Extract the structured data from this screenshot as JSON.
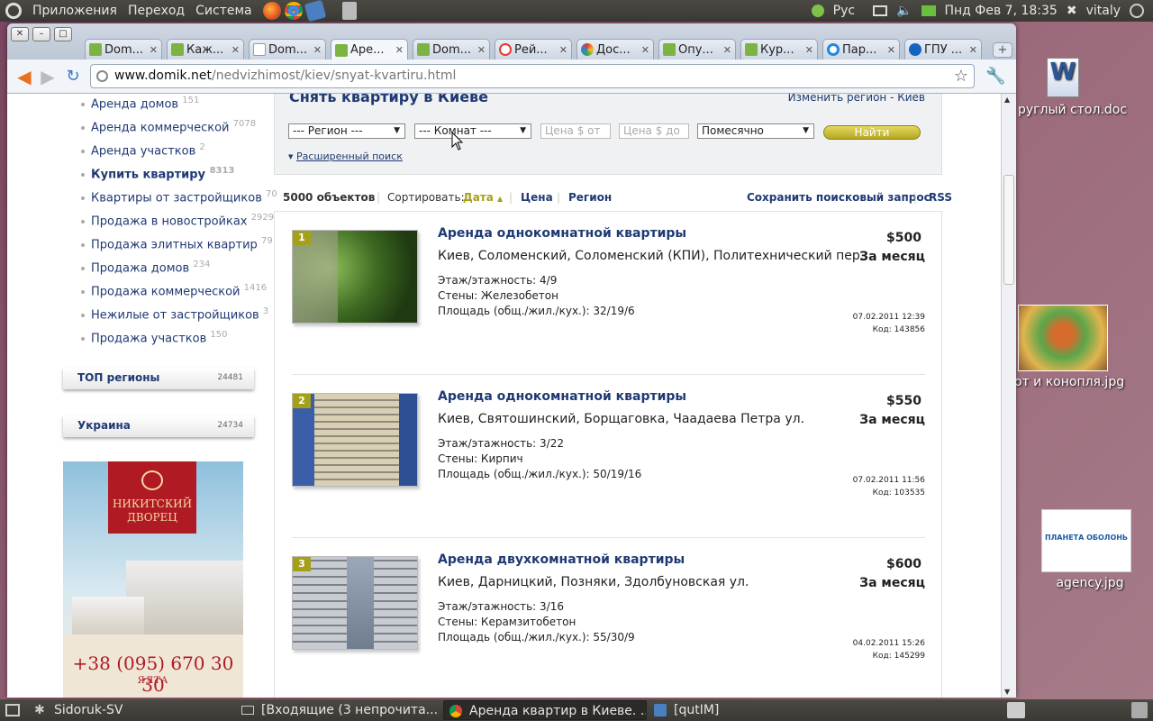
{
  "top_panel": {
    "menus": [
      "Приложения",
      "Переход",
      "Система"
    ],
    "keyboard_layout": "Рус",
    "datetime": "Пнд Фев  7, 18:35",
    "user": "vitaly"
  },
  "desktop": {
    "icons": [
      {
        "label": "руглый стол.doc",
        "icon": "word-doc-icon"
      },
      {
        "label": "от и конопля.jpg",
        "icon": "image-icon"
      },
      {
        "label": "agency.jpg",
        "icon": "image-icon",
        "text": "ПЛАНЕТА ОБОЛОНЬ"
      }
    ]
  },
  "browser": {
    "tabs": [
      {
        "label": "Dom..."
      },
      {
        "label": "Каж..."
      },
      {
        "label": "Dom..."
      },
      {
        "label": "Аре..."
      },
      {
        "label": "Dom..."
      },
      {
        "label": "Рей..."
      },
      {
        "label": "Дос..."
      },
      {
        "label": "Опу..."
      },
      {
        "label": "Кур..."
      },
      {
        "label": "Пар..."
      },
      {
        "label": "ГПУ ..."
      }
    ],
    "active_tab": 3,
    "url_host": "www.domik.net",
    "url_path": "/nedvizhimost/kiev/snyat-kvartiru.html"
  },
  "sidebar": {
    "items": [
      {
        "label": "Аренда домов",
        "count": "151"
      },
      {
        "label": "Аренда коммерческой",
        "count": "7078"
      },
      {
        "label": "Аренда участков",
        "count": "2"
      },
      {
        "label": "Купить квартиру",
        "count": "8313"
      },
      {
        "label": "Квартиры от застройщиков",
        "count": "70"
      },
      {
        "label": "Продажа в новостройках",
        "count": "2929"
      },
      {
        "label": "Продажа элитных квартир",
        "count": "79"
      },
      {
        "label": "Продажа домов",
        "count": "234"
      },
      {
        "label": "Продажа коммерческой",
        "count": "1416"
      },
      {
        "label": "Нежилые от застройщиков",
        "count": "3"
      },
      {
        "label": "Продажа участков",
        "count": "150"
      }
    ],
    "regions": [
      {
        "label": "ТОП регионы",
        "count": "24481"
      },
      {
        "label": "Украина",
        "count": "24734"
      }
    ],
    "ad": {
      "brand": "НИКИТСКИЙ ДВОРЕЦ",
      "phone": "+38 (095) 670 30 30",
      "city": "ЯЛТА"
    }
  },
  "search": {
    "title": "Снять квартиру в Киеве",
    "change_region": "Изменить регион - Киев",
    "region": "--- Регион ---",
    "rooms": "--- Комнат ---",
    "price_from": "Цена $ от",
    "price_to": "Цена $ до",
    "period": "Помесячно",
    "find": "Найти",
    "advanced": "Расширенный поиск"
  },
  "sort": {
    "count": "5000 объектов",
    "label": "Сортировать:",
    "date": "Дата",
    "price": "Цена",
    "region": "Регион",
    "save": "Сохранить поисковый запрос",
    "rss": "RSS"
  },
  "listings": [
    {
      "num": "1",
      "title": "Аренда однокомнатной квартиры",
      "address": "Киев, Соломенский, Соломенский (КПИ), Политехнический пер.",
      "floor": "Этаж/этажность: 4/9",
      "walls": "Стены: Железобетон",
      "area": "Площадь (общ./жил./кух.): 32/19/6",
      "price": "$500",
      "period": "За месяц",
      "date": "07.02.2011 12:39",
      "code": "Код: 143856"
    },
    {
      "num": "2",
      "title": "Аренда однокомнатной квартиры",
      "address": "Киев, Святошинский, Борщаговка, Чаадаева Петра ул.",
      "floor": "Этаж/этажность: 3/22",
      "walls": "Стены: Кирпич",
      "area": "Площадь (общ./жил./кух.): 50/19/16",
      "price": "$550",
      "period": "За месяц",
      "date": "07.02.2011 11:56",
      "code": "Код: 103535"
    },
    {
      "num": "3",
      "title": "Аренда двухкомнатной квартиры",
      "address": "Киев, Дарницкий, Позняки, Здолбуновская ул.",
      "floor": "Этаж/этажность: 3/16",
      "walls": "Стены: Керамзитобетон",
      "area": "Площадь (общ./жил./кух.): 55/30/9",
      "price": "$600",
      "period": "За месяц",
      "date": "04.02.2011 15:26",
      "code": "Код: 145299"
    }
  ],
  "taskbar": {
    "items": [
      {
        "label": "Sidoruk-SV"
      },
      {
        "label": "[Входящие (3 непрочита..."
      },
      {
        "label": "Аренда квартир в Киеве. ..."
      },
      {
        "label": "[qutIM]"
      }
    ]
  }
}
